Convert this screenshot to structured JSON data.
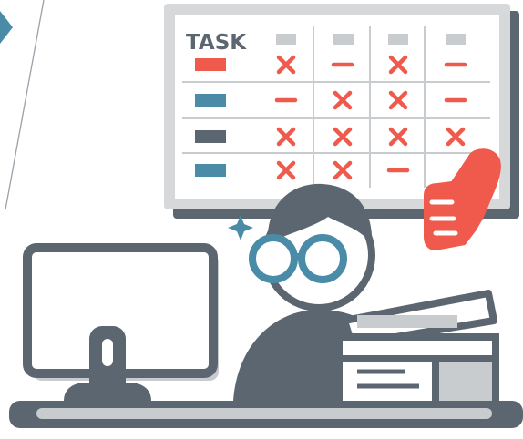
{
  "board": {
    "title": "TASK",
    "columns": 4,
    "rows": [
      {
        "swatch": "red",
        "marks": [
          "x",
          "dash",
          "x",
          "dash"
        ]
      },
      {
        "swatch": "blue",
        "marks": [
          "dash",
          "x",
          "x",
          "dash"
        ]
      },
      {
        "swatch": "gray",
        "marks": [
          "x",
          "x",
          "x",
          "x"
        ]
      },
      {
        "swatch": "blue",
        "marks": [
          "x",
          "x",
          "dash",
          ""
        ]
      }
    ]
  },
  "icons": {
    "thumb": "thumbs-up-icon",
    "sparkle": "sparkle-icon",
    "arrow": "arrow-right-icon"
  },
  "colors": {
    "outline": "#5c6670",
    "red": "#ef5a4c",
    "blue": "#4a8ba8",
    "gray": "#5c6670",
    "light_gray": "#c8ccce",
    "board_frame": "#d6d8da",
    "white": "#ffffff"
  }
}
